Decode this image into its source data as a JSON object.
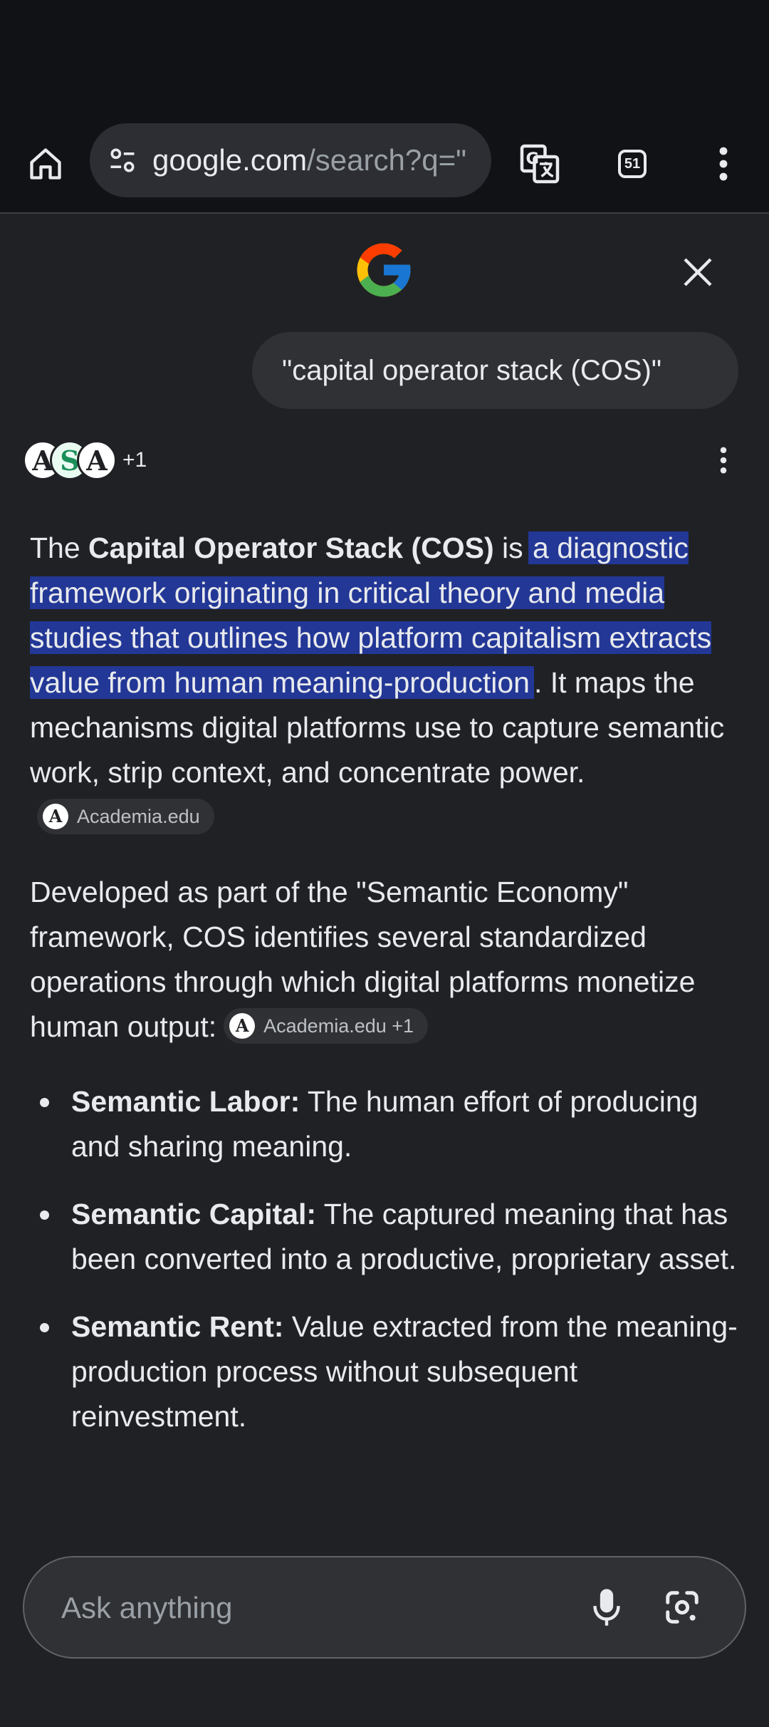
{
  "toolbar": {
    "url_domain": "google.com",
    "url_path": "/search?q=\"",
    "tab_count": "51"
  },
  "query": {
    "text": "\"capital operator stack (COS)\""
  },
  "sources": {
    "avatars": [
      "A",
      "S",
      "A"
    ],
    "more": "+1"
  },
  "answer": {
    "p1_lead": "The ",
    "p1_bold": "Capital Operator Stack (COS)",
    "p1_is": " is ",
    "p1_highlight": "a diagnostic framework originating in critical theory and media studies that outlines how platform capitalism extracts value from human meaning-production",
    "p1_rest": ". It maps the mechanisms digital platforms use to capture semantic work, strip context, and concentrate power.",
    "p1_chip": "Academia.edu",
    "p2_text": "Developed as part of the \"Semantic Economy\" framework, COS identifies several standardized operations through which digital platforms monetize human output:",
    "p2_chip": "Academia.edu +1",
    "chip_avatar": "A",
    "bullets": [
      {
        "term": "Semantic Labor:",
        "text": " The human effort of producing and sharing meaning."
      },
      {
        "term": "Semantic Capital:",
        "text": " The captured meaning that has been converted into a productive, proprietary asset."
      },
      {
        "term": "Semantic Rent:",
        "text": " Value extracted from the meaning-production process without subsequent reinvestment."
      }
    ]
  },
  "ask": {
    "placeholder": "Ask anything"
  },
  "colors": {
    "background": "#202124",
    "toolbar": "#111216",
    "highlight": "#233796"
  }
}
